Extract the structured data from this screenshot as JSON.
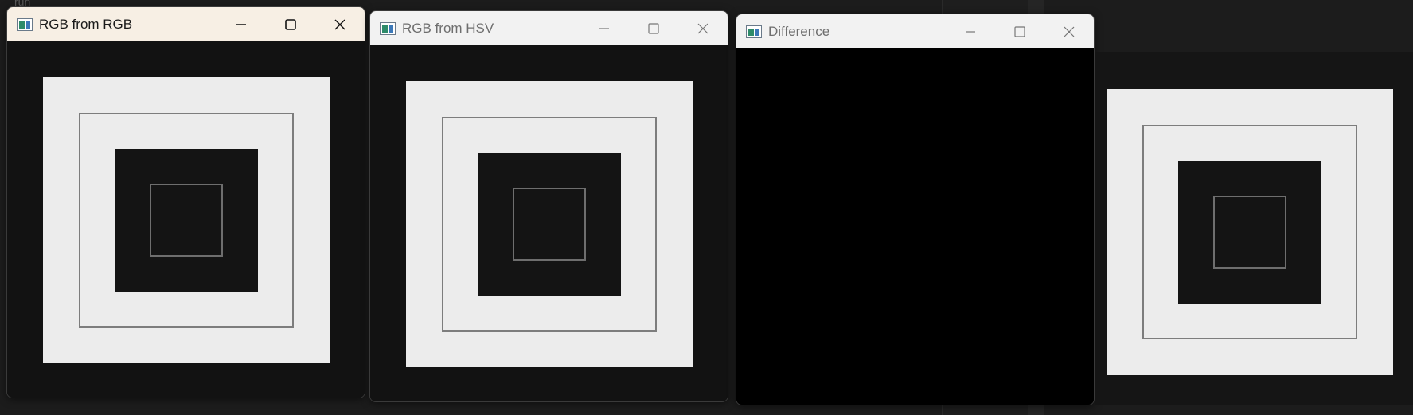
{
  "background": {
    "partial_text": "run"
  },
  "windows": [
    {
      "title": "RGB from RGB",
      "state": "active",
      "content": "target-pattern",
      "controls": [
        "minimize-icon",
        "maximize-icon",
        "close-icon"
      ]
    },
    {
      "title": "RGB from HSV",
      "state": "inactive",
      "content": "target-pattern",
      "controls": [
        "minimize-icon",
        "maximize-icon",
        "close-icon"
      ]
    },
    {
      "title": "Difference",
      "state": "inactive",
      "content": "black",
      "controls": [
        "minimize-icon",
        "maximize-icon",
        "close-icon"
      ]
    }
  ],
  "colors": {
    "active_titlebar": "#f7efe4",
    "inactive_titlebar": "#f2f2f2",
    "pattern_white": "#ececec",
    "pattern_dark": "#141414",
    "difference_fill": "#000000"
  }
}
